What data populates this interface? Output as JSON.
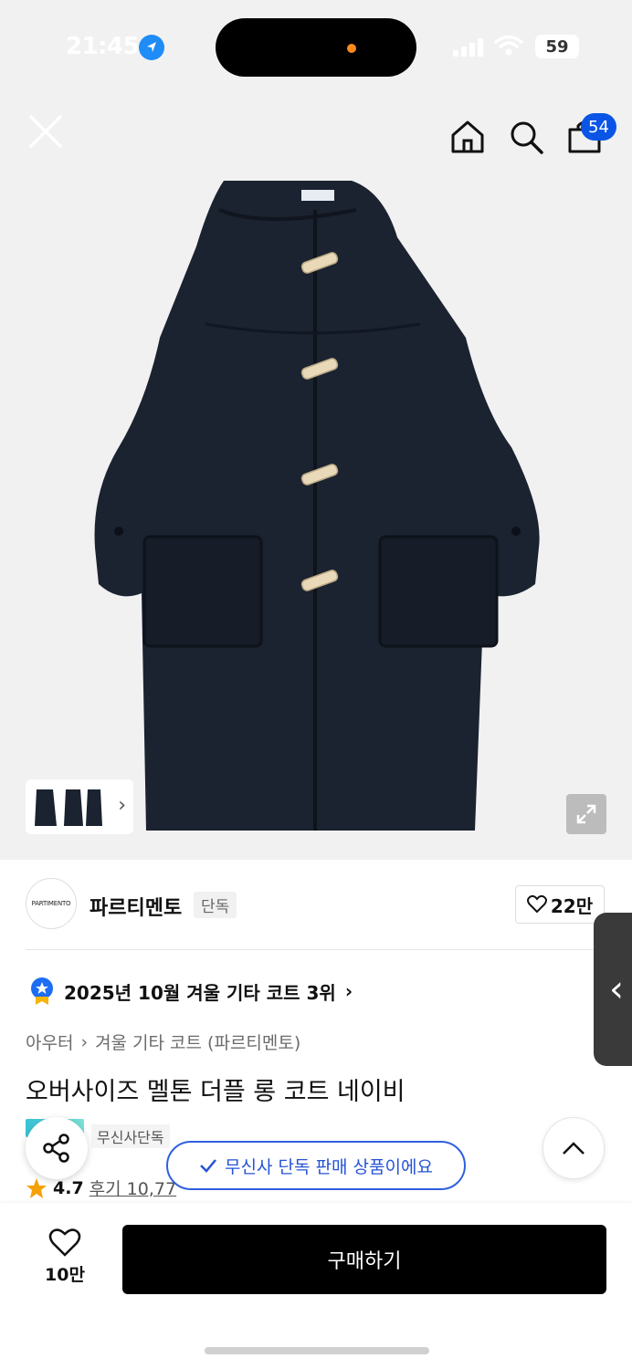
{
  "status_bar": {
    "time": "21:45"
  },
  "nav": {
    "cart_count": "54"
  },
  "brand": {
    "logo_text": "PARTIMENTO",
    "name": "파르티멘토",
    "tag": "단독",
    "likes": "22만"
  },
  "ranking": {
    "text": "2025년 10월 겨울 기타 코트 3위"
  },
  "breadcrumb": {
    "items": [
      "아우터",
      "겨울 기타 코트 (파르티멘토)"
    ]
  },
  "product": {
    "title": "오버사이즈 멜톤 더플 롱 코트 네이비"
  },
  "exclusive": {
    "tag": "무신사단독"
  },
  "toast": {
    "text": "무신사 단독 판매 상품이에요"
  },
  "rating": {
    "score": "4.7",
    "review_text": "후기 10,77"
  },
  "bottom": {
    "wish_count": "10만",
    "buy_label": "구매하기"
  },
  "colors": {
    "accent": "#0a55e6",
    "toast": "#2f5fe0",
    "coat": "#1b2230",
    "toggle": "#e9d9b8"
  }
}
